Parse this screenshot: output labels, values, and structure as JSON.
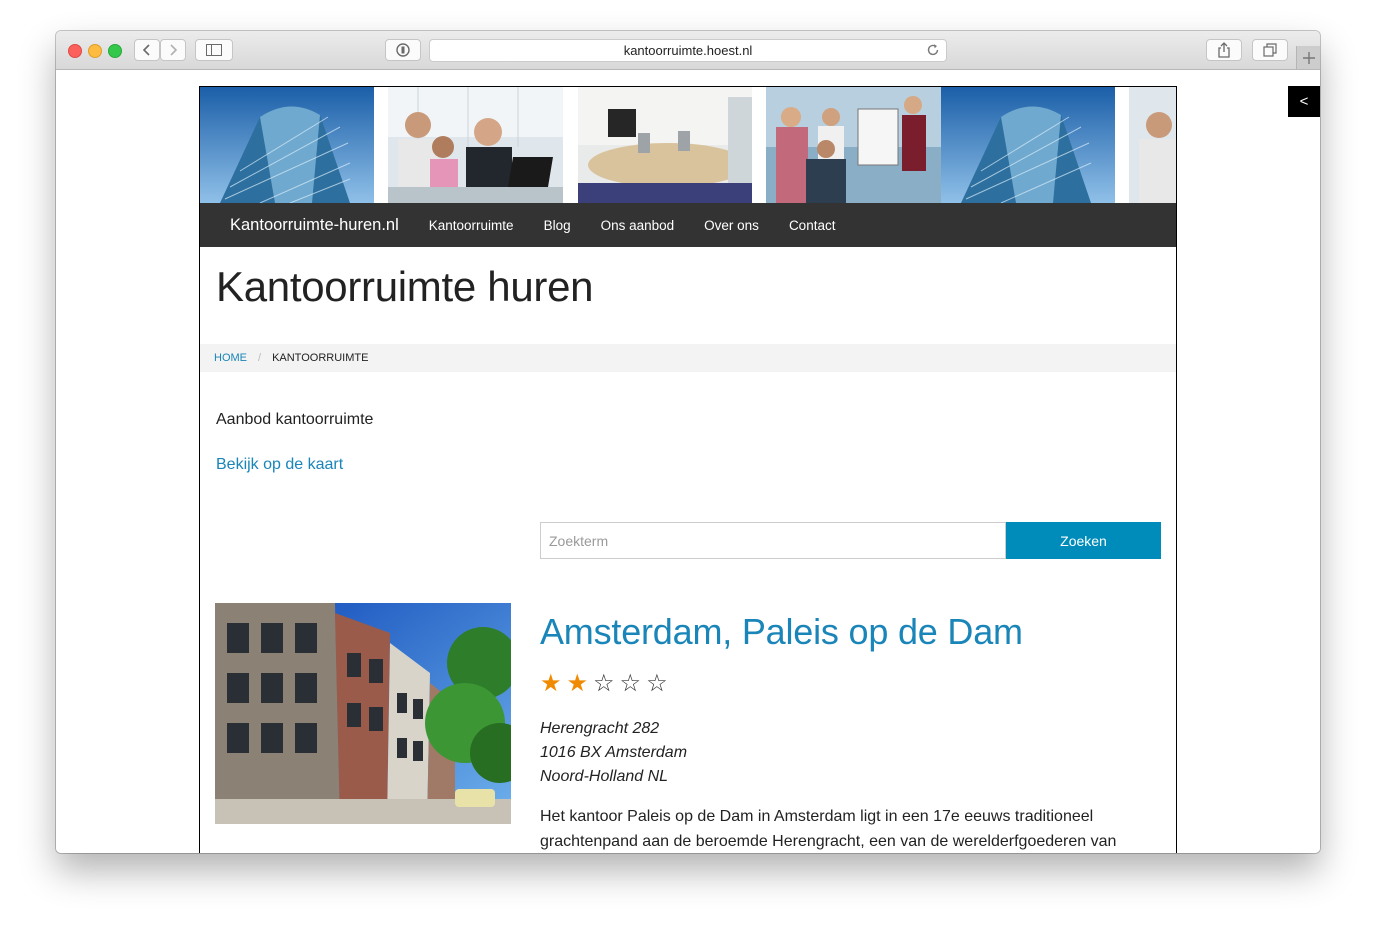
{
  "browser": {
    "url": "kantoorruimte.hoest.nl",
    "icons": {
      "back": "chevron-left-icon",
      "forward": "chevron-right-icon",
      "sidebar": "sidebar-icon",
      "reader": "reader-icon",
      "reload": "reload-icon",
      "share": "share-icon",
      "tabs": "tabs-icon",
      "new_tab": "plus-icon"
    }
  },
  "side_toggle": {
    "label": "<"
  },
  "nav": {
    "brand": "Kantoorruimte-huren.nl",
    "items": [
      "Kantoorruimte",
      "Blog",
      "Ons aanbod",
      "Over ons",
      "Contact"
    ]
  },
  "page": {
    "title": "Kantoorruimte huren"
  },
  "breadcrumb": {
    "home": "HOME",
    "separator": "/",
    "current": "KANTOORRUIMTE"
  },
  "content": {
    "heading": "Aanbod kantoorruimte",
    "map_link": "Bekijk op de kaart"
  },
  "search": {
    "placeholder": "Zoekterm",
    "value": "",
    "button": "Zoeken"
  },
  "listing": {
    "title": "Amsterdam, Paleis op de Dam",
    "rating": 2,
    "rating_max": 5,
    "address": [
      "Herengracht 282",
      "1016 BX Amsterdam",
      "Noord-Holland NL"
    ],
    "description": "Het kantoor Paleis op de Dam in Amsterdam ligt in een 17e eeuws traditioneel grachtenpand aan de beroemde Herengracht, een van de werelderfgoederen van"
  },
  "colors": {
    "accent": "#008cba",
    "link": "#1a85b8",
    "navbar": "#333333",
    "star": "#f08a00",
    "breadcrumb_bg": "#f3f3f3"
  }
}
